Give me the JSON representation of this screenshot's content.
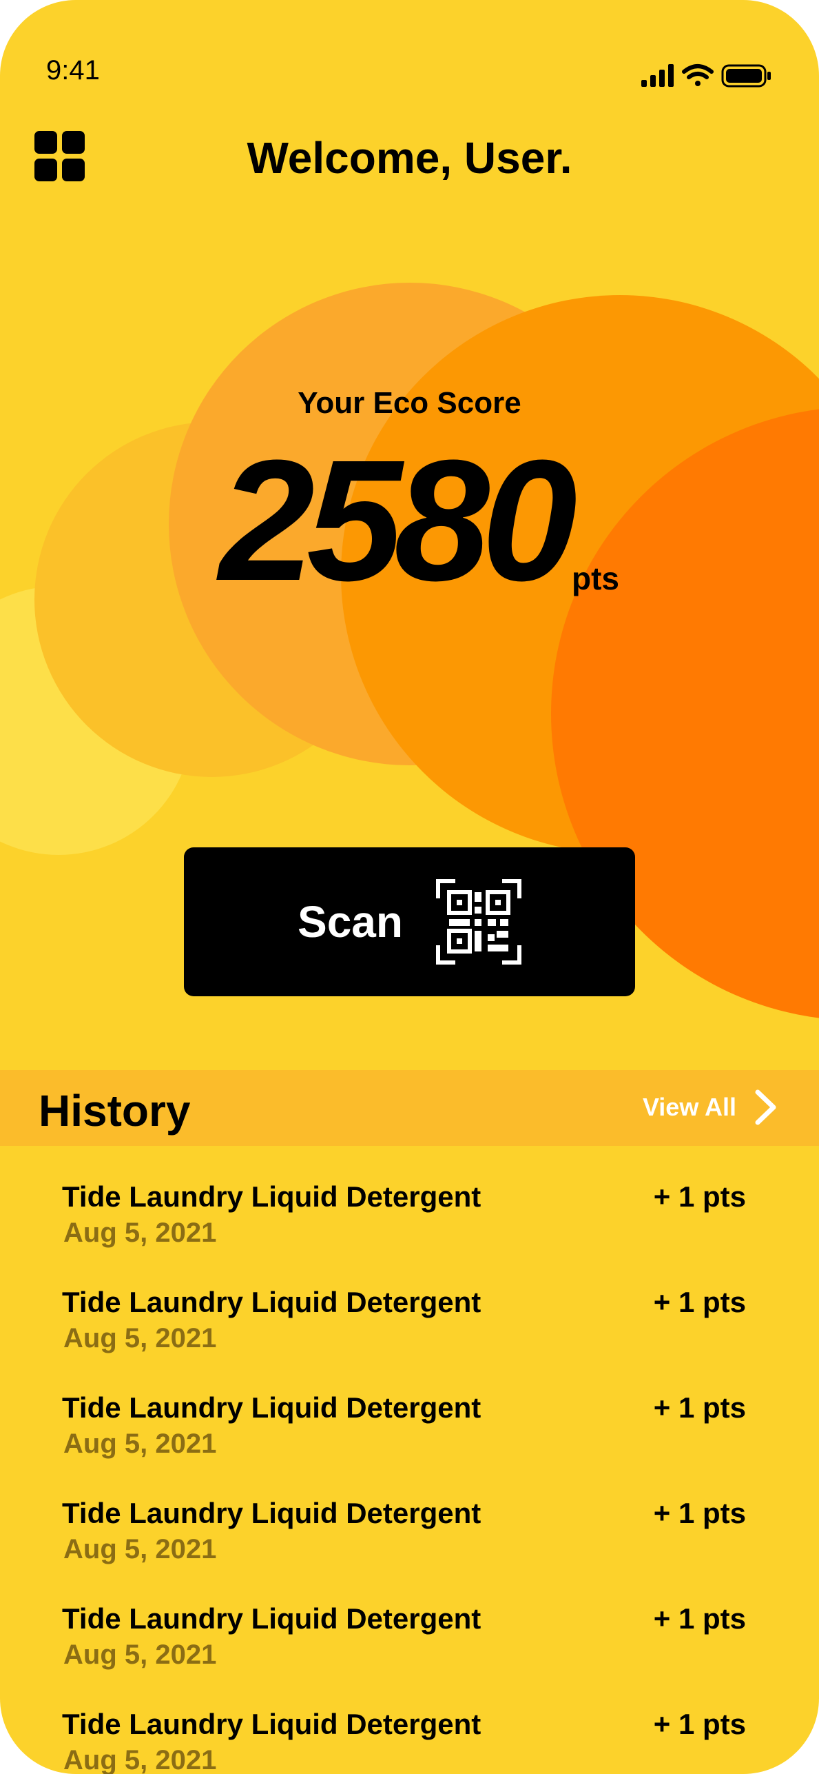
{
  "status_bar": {
    "time": "9:41",
    "icons": [
      "signal-icon",
      "wifi-icon",
      "battery-icon"
    ]
  },
  "header": {
    "title": "Welcome, User.",
    "menu_icon": "grid-menu-icon"
  },
  "score": {
    "label": "Your Eco Score",
    "value": "2580",
    "unit": "pts"
  },
  "scan": {
    "label": "Scan",
    "icon": "qr-code-icon"
  },
  "history": {
    "title": "History",
    "view_all_label": "View All",
    "items": [
      {
        "name": "Tide Laundry Liquid Detergent",
        "date": "Aug 5, 2021",
        "points": "+ 1 pts"
      },
      {
        "name": "Tide Laundry Liquid Detergent",
        "date": "Aug 5, 2021",
        "points": "+ 1 pts"
      },
      {
        "name": "Tide Laundry Liquid Detergent",
        "date": "Aug 5, 2021",
        "points": "+ 1 pts"
      },
      {
        "name": "Tide Laundry Liquid Detergent",
        "date": "Aug 5, 2021",
        "points": "+ 1 pts"
      },
      {
        "name": "Tide Laundry Liquid Detergent",
        "date": "Aug 5, 2021",
        "points": "+ 1 pts"
      },
      {
        "name": "Tide Laundry Liquid Detergent",
        "date": "Aug 5, 2021",
        "points": "+ 1 pts"
      }
    ]
  },
  "colors": {
    "background": "#FCD22B",
    "history_header": "#FBBC2B",
    "circle_light": "#FDDF49",
    "circle_yellow": "#FBC129",
    "circle_amber": "#FBA92C",
    "circle_orange": "#FC9803",
    "circle_deep_orange": "#FF7A02",
    "date_text": "#8B6D14"
  }
}
